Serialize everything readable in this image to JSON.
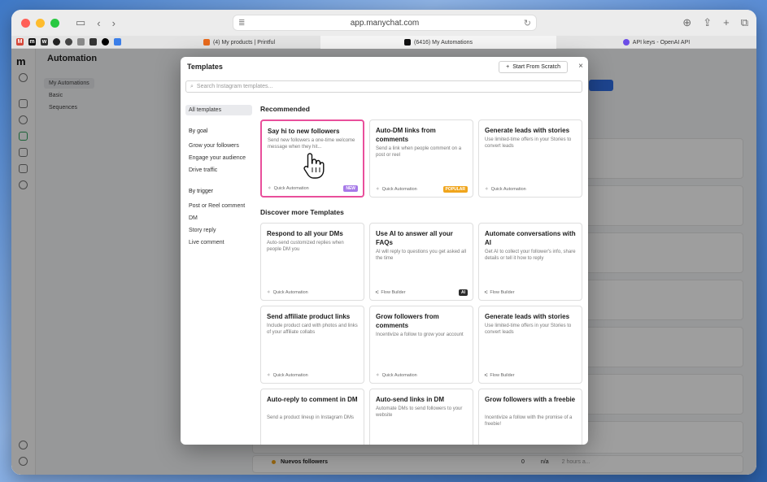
{
  "browser": {
    "url": "app.manychat.com",
    "tabs": [
      {
        "label": "(4) My products | Printful"
      },
      {
        "label": "(6416) My Automations"
      },
      {
        "label": "API keys - OpenAI API"
      }
    ]
  },
  "app": {
    "title": "Automation",
    "side_items": [
      "My Automations",
      "Basic",
      "Sequences"
    ],
    "bg_row_label": "Nuevos followers",
    "bg_row_count": "0",
    "bg_row_na": "n/a",
    "bg_row_time": "2 hours a..."
  },
  "modal": {
    "title": "Templates",
    "start_button": "Start From Scratch",
    "search_placeholder": "Search Instagram templates...",
    "filters": {
      "all": "All templates",
      "by_goal": "By goal",
      "goals": [
        "Grow your followers",
        "Engage your audience",
        "Drive traffic"
      ],
      "by_trigger": "By trigger",
      "triggers": [
        "Post or Reel comment",
        "DM",
        "Story reply",
        "Live comment"
      ]
    },
    "recommended_title": "Recommended",
    "discover_title": "Discover more Templates",
    "recommended": [
      {
        "title": "Say hi to new followers",
        "desc": "Send new followers a one-time welcome message when they hit...",
        "footer": "Quick Automation",
        "badge": "NEW"
      },
      {
        "title": "Auto-DM links from comments",
        "desc": "Send a link when people comment on a post or reel",
        "footer": "Quick Automation",
        "badge": "POPULAR"
      },
      {
        "title": "Generate leads with stories",
        "desc": "Use limited-time offers in your Stories to convert leads",
        "footer": "Quick Automation",
        "badge": ""
      }
    ],
    "discover": [
      {
        "title": "Respond to all your DMs",
        "desc": "Auto-send customized replies when people DM you",
        "footer": "Quick Automation",
        "badge": ""
      },
      {
        "title": "Use AI to answer all your FAQs",
        "desc": "AI will reply to questions you get asked all the time",
        "footer": "Flow Builder",
        "badge": "AI"
      },
      {
        "title": "Automate conversations with AI",
        "desc": "Get AI to collect your follower's info, share details or tell it how to reply",
        "footer": "Flow Builder",
        "badge": ""
      },
      {
        "title": "Send affiliate product links",
        "desc": "Include product card with photos and links of your affiliate collabs",
        "footer": "Quick Automation",
        "badge": ""
      },
      {
        "title": "Grow followers from comments",
        "desc": "Incentivize a follow to grow your account",
        "footer": "Quick Automation",
        "badge": ""
      },
      {
        "title": "Generate leads with stories",
        "desc": "Use limited-time offers in your Stories to convert leads",
        "footer": "Flow Builder",
        "badge": ""
      },
      {
        "title": "Auto-reply to comment in DM",
        "desc": "Send a product lineup in Instagram DMs",
        "footer": "",
        "badge": ""
      },
      {
        "title": "Auto-send links in DM",
        "desc": "Automate DMs to send followers to your website",
        "footer": "",
        "badge": ""
      },
      {
        "title": "Grow followers with a freebie",
        "desc": "Incentivize a follow with the promise of a freebie!",
        "footer": "",
        "badge": ""
      }
    ]
  },
  "colors": {
    "highlight": "#e94f9b",
    "new_badge": "#a77ae8",
    "popular_badge": "#f0a51c",
    "ai_badge": "#2b2b2b",
    "accent": "#2f6fe6"
  },
  "icons": {
    "quick_automation": "sparkle-icon",
    "flow_builder": "flow-icon",
    "cursor": "hand-pointer-icon"
  }
}
